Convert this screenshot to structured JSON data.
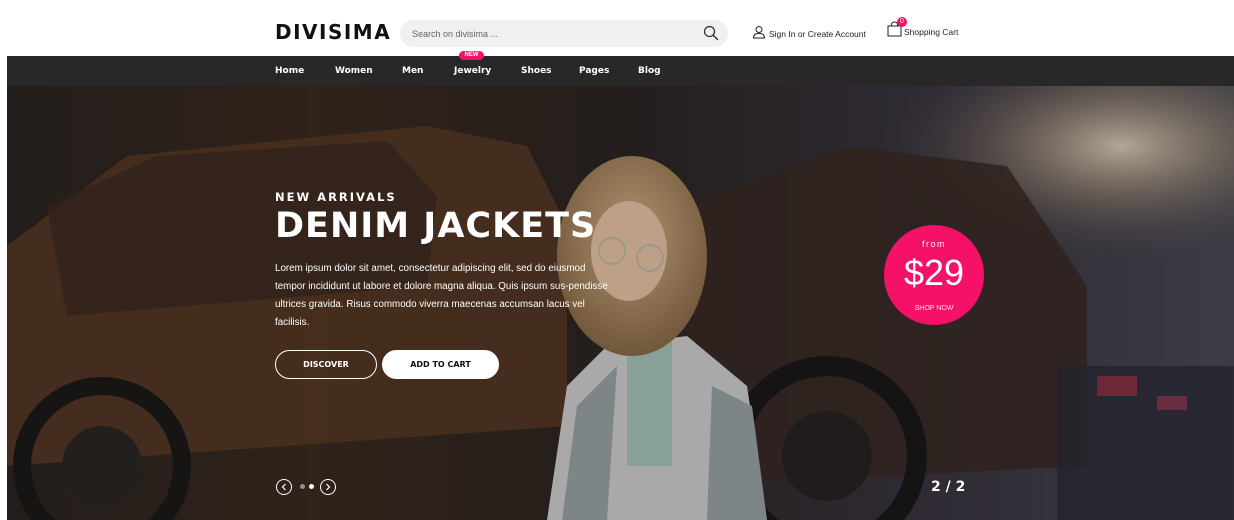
{
  "brand": {
    "logo_text": "DIVISIMA"
  },
  "search": {
    "placeholder": "Search on divisima ...",
    "value": ""
  },
  "account": {
    "label": "Sign In or Create Account"
  },
  "cart": {
    "label": "Shopping Cart",
    "count": "0"
  },
  "nav": {
    "items": [
      {
        "label": "Home"
      },
      {
        "label": "Women"
      },
      {
        "label": "Men"
      },
      {
        "label": "Jewelry",
        "badge": "NEW"
      },
      {
        "label": "Shoes"
      },
      {
        "label": "Pages"
      },
      {
        "label": "Blog"
      }
    ]
  },
  "hero": {
    "tagline": "NEW ARRIVALS",
    "title": "DENIM JACKETS",
    "text": "Lorem ipsum dolor sit amet, consectetur adipiscing elit, sed do eiusmod tempor incididunt ut labore et dolore magna aliqua. Quis ipsum sus-pendisse ultrices gravida. Risus commodo viverra maecenas accumsan lacus vel facilisis.",
    "buttons": {
      "discover": "DISCOVER",
      "add_to_cart": "ADD TO CART"
    },
    "promo": {
      "from": "from",
      "price": "$29",
      "cta": "SHOP NOW"
    },
    "slider": {
      "counter": "2 / 2",
      "active_index": 2,
      "total": 2
    }
  },
  "colors": {
    "accent": "#f51167",
    "nav_bg": "#282828"
  }
}
